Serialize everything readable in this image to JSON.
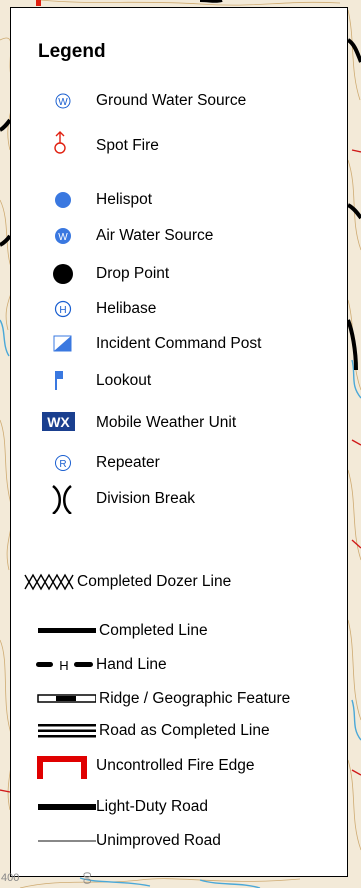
{
  "legend": {
    "title": "Legend",
    "items": [
      {
        "icon": "ground-water-source-icon",
        "label": "Ground Water Source"
      },
      {
        "icon": "spot-fire-icon",
        "label": "Spot Fire"
      },
      {
        "icon": "helispot-icon",
        "label": "Helispot"
      },
      {
        "icon": "air-water-source-icon",
        "label": "Air Water Source"
      },
      {
        "icon": "drop-point-icon",
        "label": "Drop Point"
      },
      {
        "icon": "helibase-icon",
        "label": "Helibase"
      },
      {
        "icon": "incident-command-post-icon",
        "label": "Incident Command Post"
      },
      {
        "icon": "lookout-icon",
        "label": "Lookout"
      },
      {
        "icon": "mobile-weather-unit-icon",
        "label": "Mobile Weather Unit",
        "badge": "WX"
      },
      {
        "icon": "repeater-icon",
        "label": "Repeater"
      },
      {
        "icon": "division-break-icon",
        "label": "Division Break"
      },
      {
        "icon": "completed-dozer-line-icon",
        "label": "Completed Dozer Line"
      },
      {
        "icon": "completed-line-icon",
        "label": "Completed Line"
      },
      {
        "icon": "hand-line-icon",
        "label": "Hand Line"
      },
      {
        "icon": "ridge-geographic-feature-icon",
        "label": "Ridge / Geographic Feature"
      },
      {
        "icon": "road-as-completed-line-icon",
        "label": "Road as Completed Line"
      },
      {
        "icon": "uncontrolled-fire-edge-icon",
        "label": "Uncontrolled Fire Edge"
      },
      {
        "icon": "light-duty-road-icon",
        "label": "Light-Duty Road"
      },
      {
        "icon": "unimproved-road-icon",
        "label": "Unimproved Road"
      }
    ]
  },
  "map": {
    "labels": [
      "400",
      "00"
    ],
    "colors": {
      "background": "#f3ead8",
      "contour": "#c8a060",
      "water": "#4aa8d8",
      "boundary": "#d01818",
      "fire_line": "#000000",
      "helispot": "#3a78e0",
      "wx_badge": "#1a3f8f",
      "spot_fire": "#e02010",
      "uncontrolled_edge": "#e00000"
    }
  }
}
